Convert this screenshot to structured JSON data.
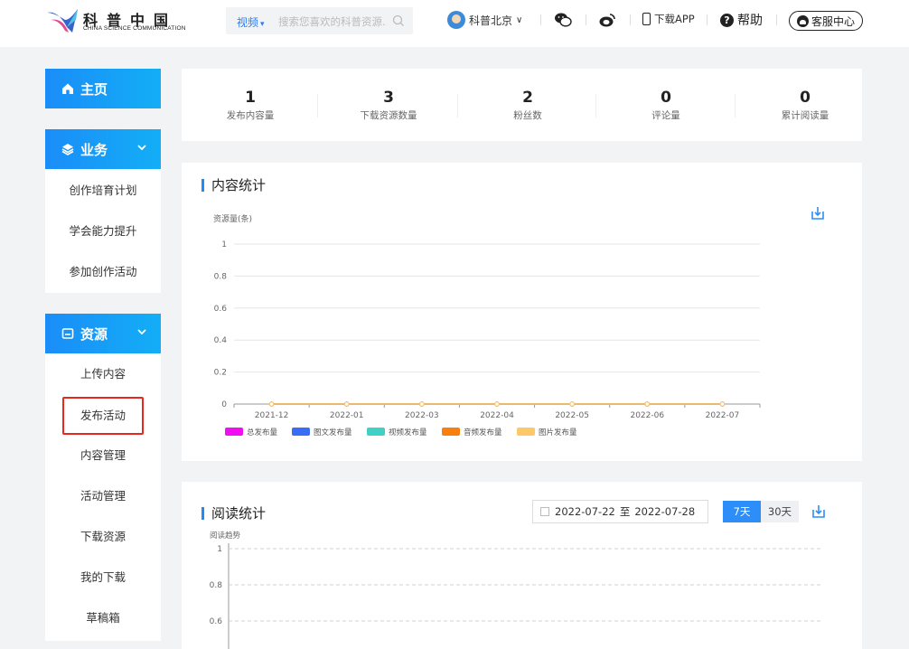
{
  "header": {
    "logo_cn": "科普中国",
    "logo_en": "CHINA SCIENCE COMMUNICATION",
    "search_category": "视频",
    "search_placeholder": "搜索您喜欢的科普资源...",
    "user_name": "科普北京",
    "download_app": "下载APP",
    "help": "帮助",
    "service": "客服中心",
    "colors": {
      "accent": "#2b7cf6"
    }
  },
  "sidebar": {
    "home": "主页",
    "business": "业务",
    "business_items": [
      "创作培育计划",
      "学会能力提升",
      "参加创作活动"
    ],
    "resources": "资源",
    "resource_items": [
      "上传内容",
      "发布活动",
      "内容管理",
      "活动管理",
      "下载资源",
      "我的下载",
      "草稿箱"
    ],
    "active_item": "发布活动"
  },
  "stats": [
    {
      "value": "1",
      "label": "发布内容量"
    },
    {
      "value": "3",
      "label": "下载资源数量"
    },
    {
      "value": "2",
      "label": "粉丝数"
    },
    {
      "value": "0",
      "label": "评论量"
    },
    {
      "value": "0",
      "label": "累计阅读量"
    }
  ],
  "content_panel": {
    "title": "内容统计"
  },
  "reading_panel": {
    "title": "阅读统计",
    "date_start": "2022-07-22",
    "date_sep": "至",
    "date_end": "2022-07-28",
    "range_7": "7天",
    "range_30": "30天"
  },
  "chart_data": [
    {
      "type": "line",
      "ylabel": "资源量(条)",
      "categories": [
        "2021-12",
        "2022-01",
        "2022-03",
        "2022-04",
        "2022-05",
        "2022-06",
        "2022-07"
      ],
      "ylim": [
        0,
        1
      ],
      "yticks": [
        "1",
        "0.8",
        "0.6",
        "0.4",
        "0.2",
        "0"
      ],
      "series": [
        {
          "name": "总发布量",
          "color": "#f10ff1",
          "values": [
            0,
            0,
            0,
            0,
            0,
            0,
            0
          ]
        },
        {
          "name": "图文发布量",
          "color": "#3a6df5",
          "values": [
            0,
            0,
            0,
            0,
            0,
            0,
            0
          ]
        },
        {
          "name": "视频发布量",
          "color": "#3ed0c9",
          "values": [
            0,
            0,
            0,
            0,
            0,
            0,
            0
          ]
        },
        {
          "name": "音频发布量",
          "color": "#f87f0c",
          "values": [
            0,
            0,
            0,
            0,
            0,
            0,
            0
          ]
        },
        {
          "name": "图片发布量",
          "color": "#fcc868",
          "values": [
            0,
            0,
            0,
            0,
            0,
            0,
            0
          ]
        }
      ],
      "grid": true,
      "legend": "bottom-left"
    },
    {
      "type": "line",
      "ylabel": "阅读趋势",
      "yticks": [
        "1",
        "0.8",
        "0.6"
      ],
      "ylim": [
        0,
        1
      ],
      "grid": true
    }
  ]
}
